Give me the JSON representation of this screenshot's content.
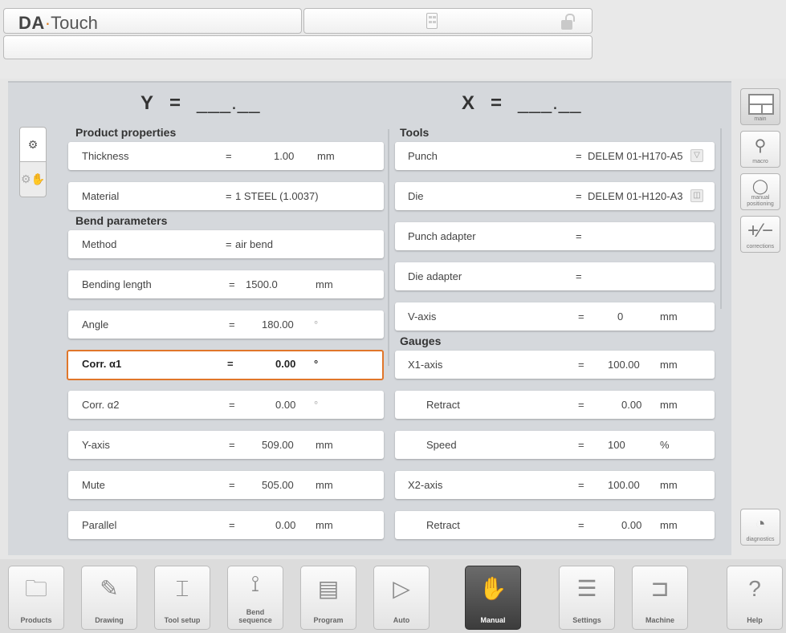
{
  "header": {
    "app_name_bold": "DA",
    "app_name_dot": "·",
    "app_name_rest": "Touch"
  },
  "axes": {
    "y_label": "Y",
    "x_label": "X",
    "equals": "=",
    "y_value": "___.__",
    "x_value": "___.__"
  },
  "left": {
    "product_title": "Product properties",
    "product_rows": [
      {
        "label": "Thickness",
        "eq": "=",
        "value": "1.00",
        "unit": "mm"
      },
      {
        "label": "Material",
        "eq": "=",
        "value": "1 STEEL (1.0037)",
        "unit": ""
      }
    ],
    "bend_title": "Bend parameters",
    "bend_rows": [
      {
        "label": "Method",
        "eq": "=",
        "value": "air bend",
        "unit": ""
      },
      {
        "label": "Bending length",
        "eq": "=",
        "value": "1500.0",
        "unit": "mm"
      },
      {
        "label": "Angle",
        "eq": "=",
        "value": "180.00",
        "unit": "°"
      },
      {
        "label": "Corr. α1",
        "eq": "=",
        "value": "0.00",
        "unit": "°"
      },
      {
        "label": "Corr. α2",
        "eq": "=",
        "value": "0.00",
        "unit": "°"
      },
      {
        "label": "Y-axis",
        "eq": "=",
        "value": "509.00",
        "unit": "mm"
      },
      {
        "label": "Mute",
        "eq": "=",
        "value": "505.00",
        "unit": "mm"
      },
      {
        "label": "Parallel",
        "eq": "=",
        "value": "0.00",
        "unit": "mm"
      }
    ]
  },
  "right": {
    "tools_title": "Tools",
    "tool_rows": [
      {
        "label": "Punch",
        "eq": "=",
        "value": "DELEM 01-H170-A5",
        "unit": ""
      },
      {
        "label": "Die",
        "eq": "=",
        "value": "DELEM 01-H120-A3",
        "unit": ""
      },
      {
        "label": "Punch adapter",
        "eq": "=",
        "value": "",
        "unit": ""
      },
      {
        "label": "Die adapter",
        "eq": "=",
        "value": "",
        "unit": ""
      },
      {
        "label": "V-axis",
        "eq": "=",
        "value": "0",
        "unit": "mm"
      }
    ],
    "gauges_title": "Gauges",
    "gauge_rows": [
      {
        "label": "X1-axis",
        "eq": "=",
        "value": "100.00",
        "unit": "mm"
      },
      {
        "label": "Retract",
        "eq": "=",
        "value": "0.00",
        "unit": "mm"
      },
      {
        "label": "Speed",
        "eq": "=",
        "value": "100",
        "unit": "%"
      },
      {
        "label": "X2-axis",
        "eq": "=",
        "value": "100.00",
        "unit": "mm"
      },
      {
        "label": "Retract",
        "eq": "=",
        "value": "0.00",
        "unit": "mm"
      }
    ]
  },
  "right_toolbar": {
    "main": "main",
    "macro": "macro",
    "manual_positioning": "manual\npositioning",
    "corrections": "corrections",
    "diagnostics": "diagnostics"
  },
  "nav": {
    "products": "Products",
    "drawing": "Drawing",
    "tool_setup": "Tool setup",
    "bend_sequence": "Bend\nsequence",
    "program": "Program",
    "auto": "Auto",
    "manual": "Manual",
    "settings": "Settings",
    "machine": "Machine",
    "help": "Help"
  },
  "colors": {
    "accent": "#e0762a",
    "panel": "#d5d8dc",
    "active_nav": "#4a4a4a"
  },
  "icons": [
    "calculator-icon",
    "unlock-icon",
    "gears-icon",
    "manual-hand-icon",
    "magnifier-icon",
    "positioning-icon",
    "plus-minus-icon",
    "gauge-icon",
    "folder-icon",
    "drawing-icon",
    "tool-setup-icon",
    "bend-sequence-icon",
    "program-icon",
    "play-icon",
    "settings-list-icon",
    "machine-icon",
    "question-icon"
  ]
}
